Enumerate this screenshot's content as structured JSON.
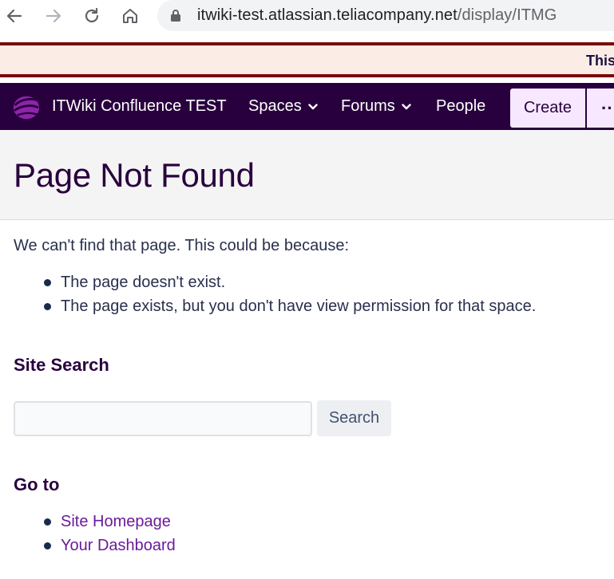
{
  "browser": {
    "url_host": "itwiki-test.atlassian.teliacompany.net",
    "url_path": "/display/ITMG"
  },
  "banner": {
    "text": "This"
  },
  "header": {
    "app_title": "ITWiki Confluence TEST",
    "nav": {
      "spaces": "Spaces",
      "forums": "Forums",
      "people": "People"
    },
    "create_label": "Create",
    "more_label": "··"
  },
  "page": {
    "title": "Page Not Found",
    "intro": "We can't find that page. This could be because:",
    "reasons": [
      "The page doesn't exist.",
      "The page exists, but you don't have view permission for that space."
    ],
    "site_search": {
      "heading": "Site Search",
      "input_value": "",
      "button_label": "Search"
    },
    "goto": {
      "heading": "Go to",
      "links": [
        "Site Homepage",
        "Your Dashboard"
      ]
    }
  },
  "colors": {
    "header_bg": "#29003e",
    "banner_border": "#7a0a0a",
    "link": "#6a1b9a",
    "accent": "#8e24aa"
  }
}
